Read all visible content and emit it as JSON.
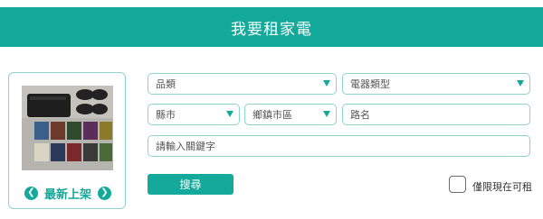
{
  "header": {
    "title": "我要租家電"
  },
  "promo": {
    "caption": "最新上架",
    "prev_icon": "chevron-left-icon",
    "next_icon": "chevron-right-icon",
    "image": "game-console-and-games-photo"
  },
  "filters": {
    "category": {
      "value": "品類"
    },
    "appliance_type": {
      "value": "電器類型"
    },
    "county": {
      "value": "縣市"
    },
    "district": {
      "value": "鄉鎮市區"
    },
    "road": {
      "placeholder": "路名"
    },
    "keyword": {
      "placeholder": "請輸入關鍵字"
    }
  },
  "actions": {
    "search_label": "搜尋",
    "rent_now_label": "僅限現在可租",
    "rent_now_checked": false
  },
  "colors": {
    "accent": "#13a99b",
    "border": "#8fd3cc"
  }
}
